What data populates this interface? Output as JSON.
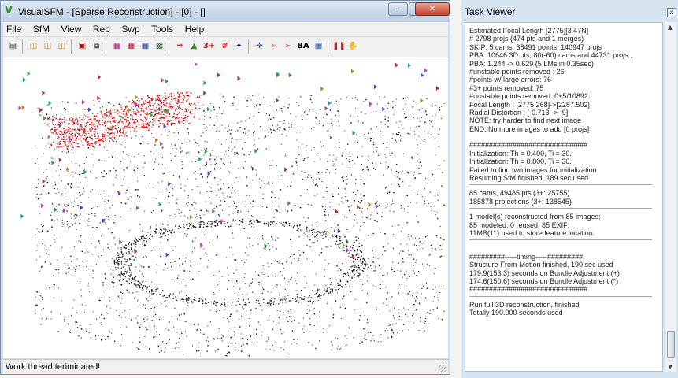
{
  "vsfm": {
    "title": "VisualSFM - [Sparse Reconstruction] - [0] - []",
    "menu": [
      "File",
      "SfM",
      "View",
      "Rep",
      "Swp",
      "Tools",
      "Help"
    ],
    "toolbar_text_buttons": {
      "three_plus": "3+",
      "ba": "BA"
    },
    "status": "Work thread teriminated!"
  },
  "task_viewer": {
    "title": "Task Viewer",
    "lines": [
      "Estimated Focal Length [2775][3.47N]",
      "# 2798 projs (474 pts and 1 merges)",
      "SKIP: 5 cams, 38491 points, 140947 projs",
      "PBA: 10646 3D pts, 80(-60) cams and 44731 projs...",
      "PBA: 1.244 -> 0.629 (5 LMs in 0.35sec)",
      "#unstable points removed :   26",
      "#points w/ large errors:      76",
      "#3+ points removed:           75",
      "#unstable points removed:    0+5/10892",
      "Focal Length : [2775.268]->[2287.502]",
      "Radial Distortion : [-0.713 -> -9]",
      "NOTE: try harder to find next image",
      "END: No more images to add [0 projs]",
      "",
      "##############################",
      "Initialization: Th = 0.400, Ti = 30.",
      "Initialization: Th = 0.800, Ti = 30.",
      "Failed to find two images for initialization",
      "Resuming SfM finished, 189 sec used",
      "RULE",
      "85 cams, 49485 pts (3+: 25755)",
      "185878 projections (3+: 138545)",
      "RULE",
      "1 model(s) reconstructed from 85 images;",
      "85 modeled; 0 reused; 85 EXIF;",
      "11MB(11) used to store feature location.",
      "RULE",
      "",
      "#########-----timing-----#########",
      "Structure-From-Motion finished, 190 sec used",
      "179.9(153.3) seconds on Bundle Adjustment (+)",
      "174.6(150.6) seconds on Bundle Adjustment (*)",
      "##############################",
      "RULE",
      "Run full 3D reconstruction, finished",
      "Totally 190.000 seconds used"
    ]
  },
  "colors": {
    "point_black": "#1a1a1a",
    "point_red": "#e01010",
    "camera_colors": [
      "#b03030",
      "#3050c0",
      "#30a040",
      "#9040b0",
      "#c08020",
      "#20a0a0",
      "#d040a0"
    ]
  }
}
